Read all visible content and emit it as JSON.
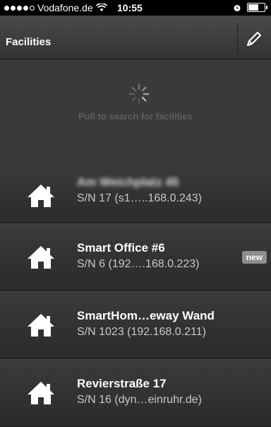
{
  "status_bar": {
    "carrier": "Vodafone.de",
    "time": "10:55"
  },
  "nav": {
    "title": "Facilities"
  },
  "refresh": {
    "hint": "Pull to search for facilities"
  },
  "facilities": [
    {
      "name": "Am Weichplatz 45",
      "serial": "S/N 17 (s1…..168.0.243)",
      "badge": ""
    },
    {
      "name": "Smart Office #6",
      "serial": "S/N 6 (192….168.0.223)",
      "badge": "new"
    },
    {
      "name": "SmartHom…eway Wand",
      "serial": "S/N 1023 (192.168.0.211)",
      "badge": ""
    },
    {
      "name": "Revierstraße 17",
      "serial": "S/N 16 (dyn…einruhr.de)",
      "badge": ""
    }
  ]
}
